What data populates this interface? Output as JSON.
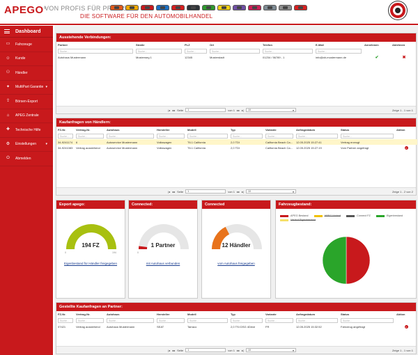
{
  "header": {
    "logo": "APEGO",
    "logo_mark": "®",
    "slogan1": "VON PROFIS FÜR PROFIS",
    "slogan2": "DIE SOFTWARE FÜR DEN AUTOMOBILHANDEL",
    "car_colors": [
      "#e05a1c",
      "#f0a800",
      "#c8191c",
      "#1b6fc2",
      "#d61e1e",
      "#2e3338",
      "#2f9a2f",
      "#f3cf13",
      "#6f4fa5",
      "#cc1e57",
      "#7d8a93",
      "#8d8d8d",
      "#d92020"
    ]
  },
  "sidebar": {
    "title": "Dashboard",
    "items": [
      {
        "label": "Fahrzeuge",
        "icon": "vehicle-icon",
        "glyph": "▭"
      },
      {
        "label": "Kunde",
        "icon": "customer-icon",
        "glyph": "☺"
      },
      {
        "label": "Händler",
        "icon": "dealer-icon",
        "glyph": "⚇"
      },
      {
        "label": "MultiPart Garantie",
        "icon": "warranty-icon",
        "glyph": "✦",
        "arrow": "▾"
      },
      {
        "label": "Börsen-Export",
        "icon": "export-icon",
        "glyph": "⇪"
      },
      {
        "label": "APEG Zentrale",
        "icon": "headquarters-icon",
        "glyph": "⌂"
      },
      {
        "label": "Technische Hilfe",
        "icon": "help-icon",
        "glyph": "✚"
      },
      {
        "label": "Einstellungen",
        "icon": "settings-icon",
        "glyph": "⚙",
        "arrow": "▾"
      },
      {
        "label": "Abmelden",
        "icon": "logout-icon",
        "glyph": "⏻"
      }
    ]
  },
  "connections": {
    "title": "Ausstehende Verbindungen:",
    "columns": [
      "Partner",
      "Straße",
      "PLZ",
      "Ort",
      "Telefon",
      "E-Mail",
      "Annehmen",
      "Ablehnen"
    ],
    "placeholder": "Suche...",
    "rows": [
      [
        "Autohaus Mustermann",
        "Musterweg 1",
        "12345",
        "Musterstadt",
        "01234 / 56789 - 1",
        "info@ah-mustermann.de"
      ]
    ],
    "pager": {
      "page_label": "Seite",
      "page_value": "1",
      "of": "von 1",
      "per_page": "10",
      "summary": "Zeige 1 - 1 von 1"
    }
  },
  "requests": {
    "title": "Kaufanfragen von Händlern:",
    "columns": [
      "FZ-Nr.",
      "Vertrag-Nr.",
      "Autohaus",
      "Hersteller",
      "Modell",
      "Typ",
      "Variante",
      "Anfragedatum",
      "Status",
      "Aktion"
    ],
    "placeholder": "Suche...",
    "rows": [
      [
        "34-9241174",
        "6",
        "Autoservice Mustermann",
        "Volkswagen",
        "T6.1 California",
        "2,0 TDI",
        "California Beach Ca...",
        "12.05.2025 15:27:41",
        "Vertrag erzeugt"
      ],
      [
        "34-9241083",
        "Vertrag ausstehend",
        "Autoservice Mustermann",
        "Volkswagen",
        "T6.1 California",
        "2,0 TDI",
        "California Beach Ca...",
        "12.05.2025 15:27:19",
        "Vom Partner angefragt"
      ]
    ],
    "pager": {
      "page_label": "Seite",
      "page_value": "1",
      "of": "von 1",
      "per_page": "10",
      "summary": "Zeige 1 - 2 von 2"
    }
  },
  "gauges": [
    {
      "title": "Export apego:",
      "value": "194 FZ",
      "min": "0",
      "max": "194",
      "fraction": 1.0,
      "color": "#a8c010",
      "link": "Eigenbestand für Händler freigegeben"
    },
    {
      "title": "Connected:",
      "value": "1 Partner",
      "min": "0",
      "max": "",
      "fraction": 0.04,
      "color": "#c8191c",
      "link": "mit Autohaus verbunden"
    },
    {
      "title": "Connected",
      "value": "12 Händler",
      "min": "",
      "max": "",
      "fraction": 0.35,
      "color": "#e8731c",
      "link": "vom Autohaus freigegeben"
    }
  ],
  "stock": {
    "title": "Fahrzeugbestand:",
    "legend": [
      {
        "label": "APEG Bestand",
        "color": "#c8191c",
        "strike": false
      },
      {
        "label": "APEG Vorlauf",
        "color": "#f0c000",
        "strike": true
      },
      {
        "label": "Connect FZ",
        "color": "#555555",
        "strike": false
      },
      {
        "label": "Eigenbestand",
        "color": "#2aa52a",
        "strike": false
      },
      {
        "label": "Verlauf Eigenbestand",
        "color": "#f5e06a",
        "strike": true
      }
    ],
    "chart_data": {
      "type": "pie",
      "labels": [
        "APEG Bestand",
        "Eigenbestand"
      ],
      "values": [
        50,
        50
      ],
      "colors": [
        "#c8191c",
        "#2aa52a"
      ]
    }
  },
  "placed": {
    "title": "Gestellte Kaufanfragen an Partner:",
    "columns": [
      "FZ-Nr.",
      "Vertrag-Nr.",
      "Autohaus",
      "Hersteller",
      "Modell",
      "Typ",
      "Variante",
      "Anfragedatum",
      "Status",
      "Aktion"
    ],
    "placeholder": "Suche...",
    "rows": [
      [
        "07421",
        "Vertrag ausstehend",
        "Autohaus Mustermann",
        "SEAT",
        "Tarraco",
        "2,0 TSI DSG 4Drive",
        "FR",
        "12.05.2025 15:32:52",
        "Fahrzeug angefragt"
      ]
    ],
    "pager": {
      "page_label": "Seite",
      "page_value": "1",
      "of": "von 1",
      "per_page": "10",
      "summary": "Zeige 1 - 1 von 1"
    }
  }
}
